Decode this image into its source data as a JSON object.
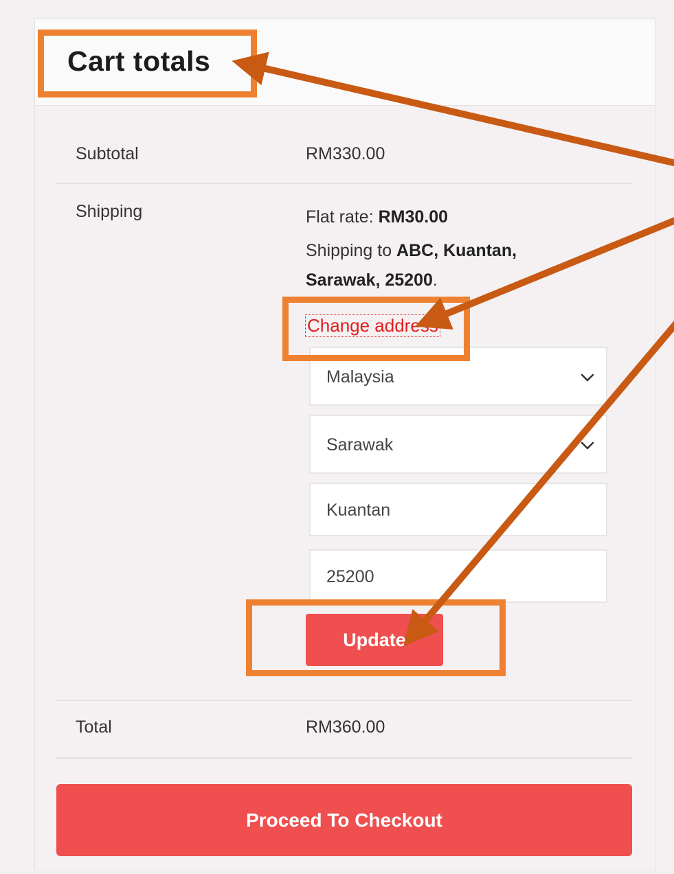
{
  "cart_totals": {
    "title": "Cart totals",
    "subtotal_label": "Subtotal",
    "subtotal_value": "RM330.00",
    "shipping_label": "Shipping",
    "flat_rate_prefix": "Flat rate: ",
    "flat_rate_value": "RM30.00",
    "shipping_to_prefix": "Shipping to ",
    "shipping_to_part1": "ABC, Kuantan,",
    "shipping_to_part2": "Sarawak, 25200",
    "shipping_to_suffix": ".",
    "change_address": "Change address",
    "country": "Malaysia",
    "state": "Sarawak",
    "city": "Kuantan",
    "postcode": "25200",
    "update_label": "Update",
    "total_label": "Total",
    "total_value": "RM360.00",
    "checkout_label": "Proceed To Checkout"
  },
  "colors": {
    "accent": "#ef4f4f",
    "link": "#e11d1d",
    "highlight": "#ee8131",
    "arrow": "#c85a14"
  },
  "icons": [
    "chevron-down-icon"
  ]
}
